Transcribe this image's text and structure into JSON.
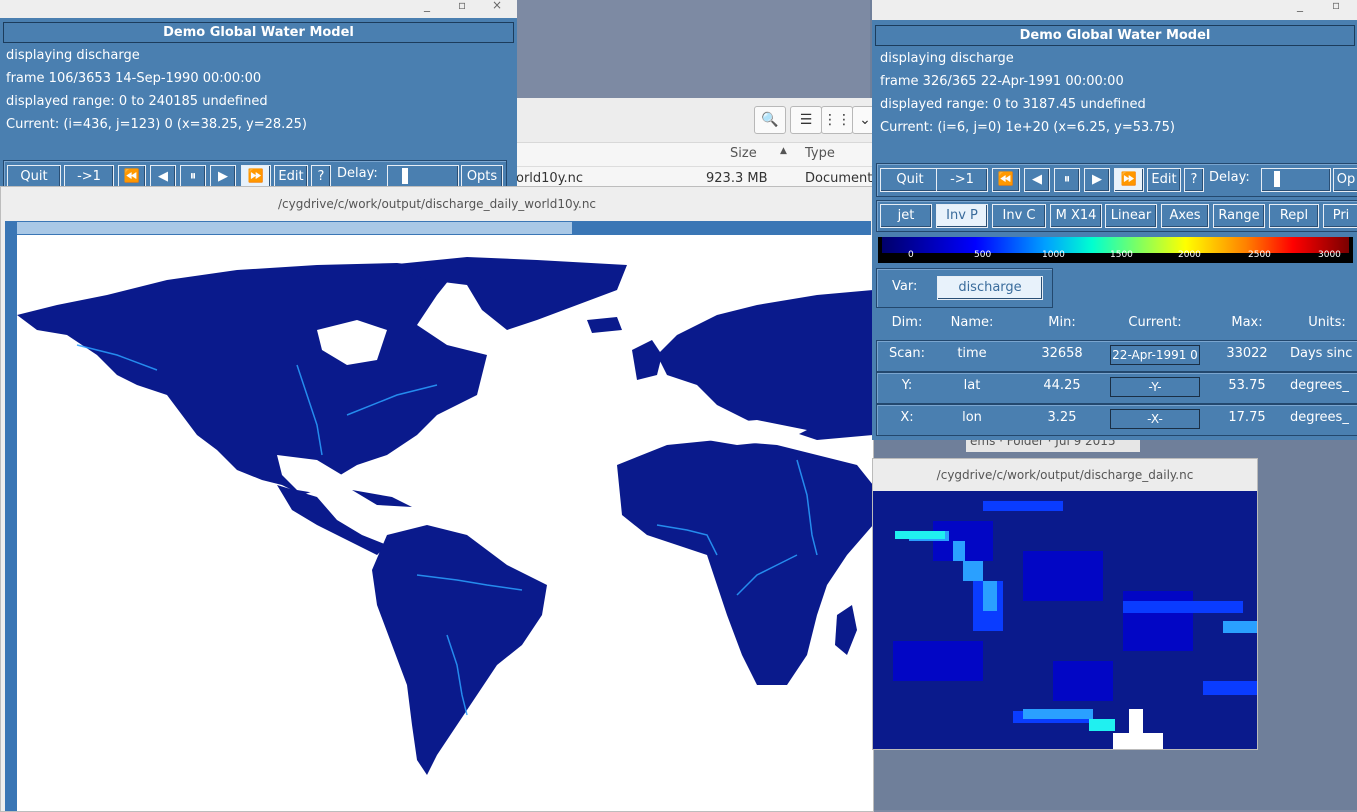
{
  "left_panel": {
    "title": "Demo Global Water Model",
    "line1": "displaying discharge",
    "line2": "frame 106/3653 14-Sep-1990 00:00:00",
    "line3": "displayed range: 0 to 240185 undefined",
    "line4": "Current: (i=436, j=123) 0 (x=38.25, y=28.25)",
    "buttons": {
      "quit": "Quit",
      "to1": "->1",
      "rewind": "⏪",
      "back": "◀",
      "pause": "⏸",
      "fwd": "▶",
      "ffwd": "⏩",
      "edit": "Edit",
      "help": "?",
      "delay": "Delay:",
      "opts": "Opts"
    }
  },
  "right_panel": {
    "title": "Demo Global Water Model",
    "line1": "displaying discharge",
    "line2": "frame 326/365 22-Apr-1991 00:00:00",
    "line3": "displayed range: 0 to 3187.45 undefined",
    "line4": "Current: (i=6, j=0) 1e+20 (x=6.25, y=53.75)",
    "buttons": {
      "quit": "Quit",
      "to1": "->1",
      "rewind": "⏪",
      "back": "◀",
      "pause": "⏸",
      "fwd": "▶",
      "ffwd": "⏩",
      "edit": "Edit",
      "help": "?",
      "delay": "Delay:",
      "opts": "Op"
    },
    "options": [
      "jet",
      "Inv P",
      "Inv C",
      "M X14",
      "Linear",
      "Axes",
      "Range",
      "Repl",
      "Pri"
    ],
    "selected_option": "Inv P",
    "colorbar_ticks": [
      "0",
      "500",
      "1000",
      "1500",
      "2000",
      "2500",
      "3000"
    ],
    "var_label": "Var:",
    "var_value": "discharge",
    "dim_headers": {
      "dim": "Dim:",
      "name": "Name:",
      "min": "Min:",
      "current": "Current:",
      "max": "Max:",
      "units": "Units:"
    },
    "dims": [
      {
        "dim": "Scan:",
        "name": "time",
        "min": "32658",
        "current": "22-Apr-1991 0",
        "max": "33022",
        "units": "Days sinc"
      },
      {
        "dim": "Y:",
        "name": "lat",
        "min": "44.25",
        "current": "-Y-",
        "max": "53.75",
        "units": "degrees_"
      },
      {
        "dim": "X:",
        "name": "lon",
        "min": "3.25",
        "current": "-X-",
        "max": "17.75",
        "units": "degrees_"
      }
    ]
  },
  "file_manager": {
    "col_size": "Size",
    "col_type": "Type",
    "row_name": "orld10y.nc",
    "row_size": "923.3 MB",
    "row_type": "Document",
    "peek_text": "ems · Folder · Jul 9 2015"
  },
  "map_window": {
    "title": "/cygdrive/c/work/output/discharge_daily_world10y.nc"
  },
  "small_window": {
    "title": "/cygdrive/c/work/output/discharge_daily.nc"
  },
  "colors": {
    "panel": "#4a7fb0",
    "ocean": "#ffffff",
    "land": "#0a1a8c",
    "river": "#2aa0ff"
  }
}
